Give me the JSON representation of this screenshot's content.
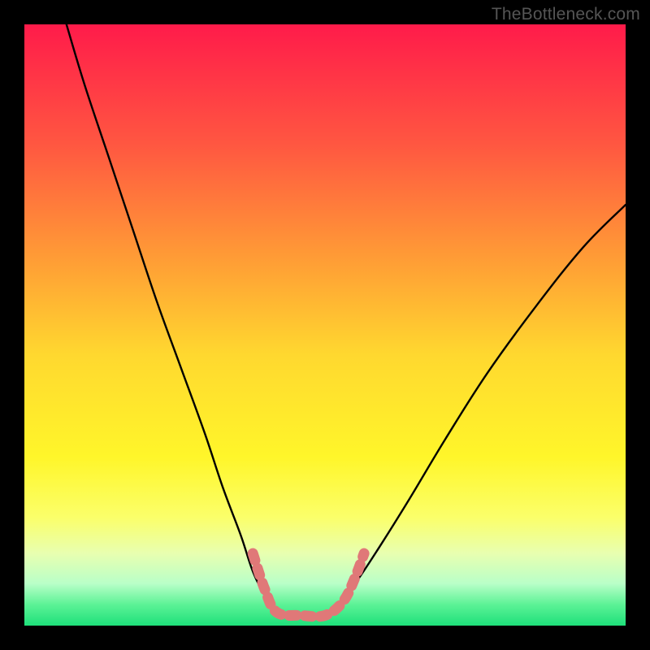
{
  "watermark": "TheBottleneck.com",
  "chart_data": {
    "type": "line",
    "title": "",
    "xlabel": "",
    "ylabel": "",
    "xlim": [
      0,
      100
    ],
    "ylim": [
      0,
      100
    ],
    "grid": false,
    "gradient": {
      "direction": "top-to-bottom",
      "stops": [
        {
          "pos": 0.0,
          "color": "#ff1b4a"
        },
        {
          "pos": 0.2,
          "color": "#ff5741"
        },
        {
          "pos": 0.4,
          "color": "#ffa035"
        },
        {
          "pos": 0.55,
          "color": "#ffd82f"
        },
        {
          "pos": 0.72,
          "color": "#fff62a"
        },
        {
          "pos": 0.82,
          "color": "#fbff6a"
        },
        {
          "pos": 0.88,
          "color": "#e8ffb0"
        },
        {
          "pos": 0.93,
          "color": "#b9ffc8"
        },
        {
          "pos": 0.965,
          "color": "#5cf296"
        },
        {
          "pos": 1.0,
          "color": "#1ee07a"
        }
      ]
    },
    "series": [
      {
        "name": "left-curve",
        "color": "#000000",
        "width": 2.4,
        "points": [
          {
            "x": 7,
            "y": 100
          },
          {
            "x": 10,
            "y": 90
          },
          {
            "x": 14,
            "y": 78
          },
          {
            "x": 18,
            "y": 66
          },
          {
            "x": 22,
            "y": 54
          },
          {
            "x": 26,
            "y": 43
          },
          {
            "x": 30,
            "y": 32
          },
          {
            "x": 33,
            "y": 23
          },
          {
            "x": 36,
            "y": 15
          },
          {
            "x": 38,
            "y": 9
          },
          {
            "x": 40,
            "y": 5
          },
          {
            "x": 42,
            "y": 2.5
          },
          {
            "x": 44,
            "y": 1.5
          },
          {
            "x": 46,
            "y": 1.5
          },
          {
            "x": 48,
            "y": 1.5
          }
        ]
      },
      {
        "name": "right-curve",
        "color": "#000000",
        "width": 2.4,
        "points": [
          {
            "x": 48,
            "y": 1.5
          },
          {
            "x": 50,
            "y": 2
          },
          {
            "x": 52,
            "y": 3.5
          },
          {
            "x": 55,
            "y": 7
          },
          {
            "x": 59,
            "y": 13
          },
          {
            "x": 64,
            "y": 21
          },
          {
            "x": 70,
            "y": 31
          },
          {
            "x": 77,
            "y": 42
          },
          {
            "x": 85,
            "y": 53
          },
          {
            "x": 93,
            "y": 63
          },
          {
            "x": 100,
            "y": 70
          }
        ]
      },
      {
        "name": "floor-overlay",
        "type": "dotted-marker",
        "color": "#e07878",
        "width": 13,
        "dash": "9 10",
        "linecap": "round",
        "points": [
          {
            "x": 38,
            "y": 12
          },
          {
            "x": 40,
            "y": 6
          },
          {
            "x": 42,
            "y": 2.2
          },
          {
            "x": 46,
            "y": 1.7
          },
          {
            "x": 50,
            "y": 1.7
          },
          {
            "x": 53,
            "y": 4
          },
          {
            "x": 55,
            "y": 8
          },
          {
            "x": 56.5,
            "y": 12
          }
        ]
      }
    ]
  }
}
